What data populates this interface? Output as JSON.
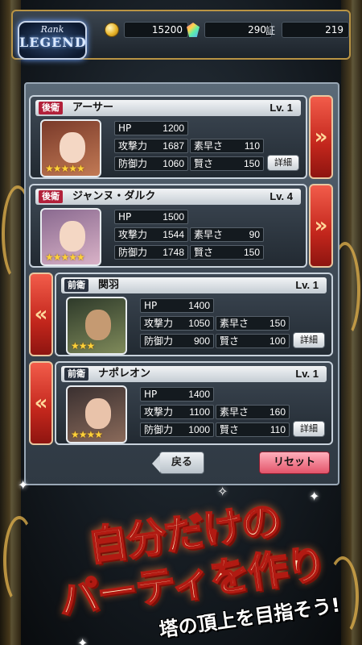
{
  "header": {
    "logo_rank": "Rank",
    "logo_legend": "LEGEND",
    "coins": "15200",
    "gems": "290",
    "cert_label": "証",
    "cert": "219"
  },
  "cards": [
    {
      "role": "後衛",
      "name": "アーサー",
      "level": "Lv.  1",
      "stars": "★★★★★",
      "hp_label": "HP",
      "hp": "1200",
      "atk_label": "攻撃力",
      "atk": "1687",
      "agi_label": "素早さ",
      "agi": "110",
      "def_label": "防御力",
      "def": "1060",
      "int_label": "賢さ",
      "int": "150",
      "detail": "詳細",
      "arrow": "»",
      "portrait_colors": [
        "#7a3a2a",
        "#c27a55"
      ]
    },
    {
      "role": "後衛",
      "name": "ジャンヌ・ダルク",
      "level": "Lv.  4",
      "stars": "★★★★★",
      "hp_label": "HP",
      "hp": "1500",
      "atk_label": "攻撃力",
      "atk": "1544",
      "agi_label": "素早さ",
      "agi": "90",
      "def_label": "防御力",
      "def": "1748",
      "int_label": "賢さ",
      "int": "150",
      "arrow": "»",
      "portrait_colors": [
        "#8a6a90",
        "#d9b2c7"
      ]
    },
    {
      "role": "前衛",
      "name": "関羽",
      "level": "Lv.  1",
      "stars": "★★★",
      "hp_label": "HP",
      "hp": "1400",
      "atk_label": "攻撃力",
      "atk": "1050",
      "agi_label": "素早さ",
      "agi": "150",
      "def_label": "防御力",
      "def": "900",
      "int_label": "賢さ",
      "int": "100",
      "detail": "詳細",
      "arrow": "«",
      "portrait_colors": [
        "#2e3a2a",
        "#7f8a5a"
      ]
    },
    {
      "role": "前衛",
      "name": "ナポレオン",
      "level": "Lv.  1",
      "stars": "★★★★",
      "hp_label": "HP",
      "hp": "1400",
      "atk_label": "攻撃力",
      "atk": "1100",
      "agi_label": "素早さ",
      "agi": "160",
      "def_label": "防御力",
      "def": "1000",
      "int_label": "賢さ",
      "int": "110",
      "detail": "詳細",
      "arrow": "«",
      "portrait_colors": [
        "#3a3030",
        "#8a6a5a"
      ]
    }
  ],
  "buttons": {
    "back": "戻る",
    "reset": "リセット"
  },
  "banner": {
    "line1": "自分だけの",
    "line2": "パーティを作り",
    "line3": "塔の頂上を目指そう!"
  }
}
